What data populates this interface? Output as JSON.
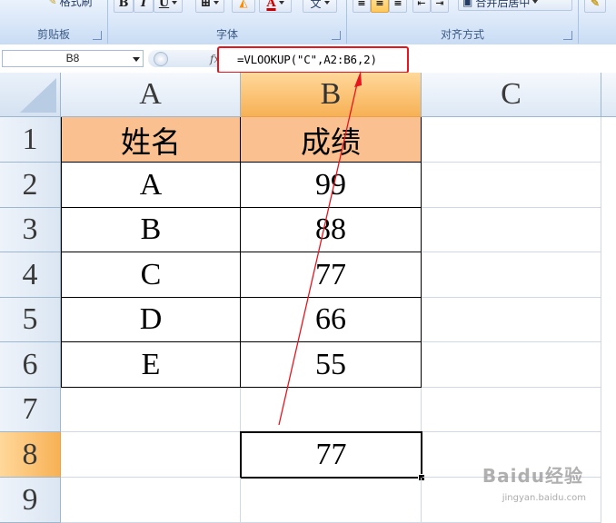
{
  "ribbon": {
    "groups": [
      {
        "label": "剪贴板"
      },
      {
        "label": "字体"
      },
      {
        "label": "对齐方式"
      }
    ],
    "buttons": {
      "format_painter": "格式刷",
      "bold": "B",
      "italic": "I",
      "underline": "U",
      "wubi": "文",
      "merge_center": "合并后居中"
    }
  },
  "formula_bar": {
    "name_box": "B8",
    "fx": "fx",
    "formula": "=VLOOKUP(\"C\",A2:B6,2)"
  },
  "sheet": {
    "columns": [
      "A",
      "B",
      "C"
    ],
    "rows": [
      "1",
      "2",
      "3",
      "4",
      "5",
      "6",
      "7",
      "8",
      "9"
    ],
    "header_row": [
      "姓名",
      "成绩"
    ],
    "data": [
      [
        "A",
        "99"
      ],
      [
        "B",
        "88"
      ],
      [
        "C",
        "77"
      ],
      [
        "D",
        "66"
      ],
      [
        "E",
        "55"
      ]
    ],
    "selected_cell": "B8",
    "selected_value": "77",
    "header_fill": "#fac090",
    "active_header_color": "#f7b155"
  },
  "annotation": {
    "color": "#e8141e"
  },
  "watermark": {
    "text": "Baidu经验",
    "url": "jingyan.baidu.com"
  }
}
